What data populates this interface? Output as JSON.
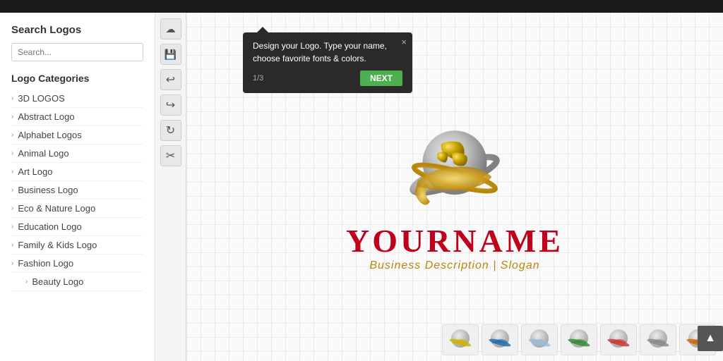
{
  "topBar": {},
  "sidebar": {
    "searchTitle": "Search Logos",
    "searchPlaceholder": "Search...",
    "categoriesTitle": "Logo Categories",
    "categories": [
      {
        "label": "3D LOGOS",
        "hasChevron": true,
        "sub": []
      },
      {
        "label": "Abstract Logo",
        "hasChevron": true,
        "sub": []
      },
      {
        "label": "Alphabet Logos",
        "hasChevron": true,
        "sub": []
      },
      {
        "label": "Animal Logo",
        "hasChevron": true,
        "sub": []
      },
      {
        "label": "Art Logo",
        "hasChevron": true,
        "sub": []
      },
      {
        "label": "Business Logo",
        "hasChevron": true,
        "sub": []
      },
      {
        "label": "Eco & Nature Logo",
        "hasChevron": true,
        "sub": []
      },
      {
        "label": "Education Logo",
        "hasChevron": true,
        "sub": []
      },
      {
        "label": "Family & Kids Logo",
        "hasChevron": true,
        "sub": []
      },
      {
        "label": "Fashion Logo",
        "hasChevron": true,
        "expanded": true,
        "sub": [
          {
            "label": "Beauty Logo"
          }
        ]
      }
    ]
  },
  "toolbar": {
    "buttons": [
      {
        "icon": "☁",
        "name": "upload-icon"
      },
      {
        "icon": "💾",
        "name": "save-icon"
      },
      {
        "icon": "↩",
        "name": "undo-icon"
      },
      {
        "icon": "↪",
        "name": "redo-icon"
      },
      {
        "icon": "↻",
        "name": "refresh-icon"
      },
      {
        "icon": "✂",
        "name": "cut-icon"
      }
    ]
  },
  "tooltip": {
    "text": "Design your Logo. Type your name, choose favorite fonts & colors.",
    "closeLabel": "×",
    "pageIndicator": "1/3",
    "nextLabel": "NEXT"
  },
  "logoDisplay": {
    "mainText": "YOURNAME",
    "subText": "Business Description | Slogan"
  },
  "thumbnails": [
    {
      "id": 1,
      "color": "#c8b400"
    },
    {
      "id": 2,
      "color": "#1a6bb0"
    },
    {
      "id": 3,
      "color": "#9abbd4"
    },
    {
      "id": 4,
      "color": "#2e8b2e"
    },
    {
      "id": 5,
      "color": "#cc3333"
    },
    {
      "id": 6,
      "color": "#888"
    },
    {
      "id": 7,
      "color": "#cc6600"
    }
  ],
  "scrollTopButton": {
    "icon": "▲"
  }
}
